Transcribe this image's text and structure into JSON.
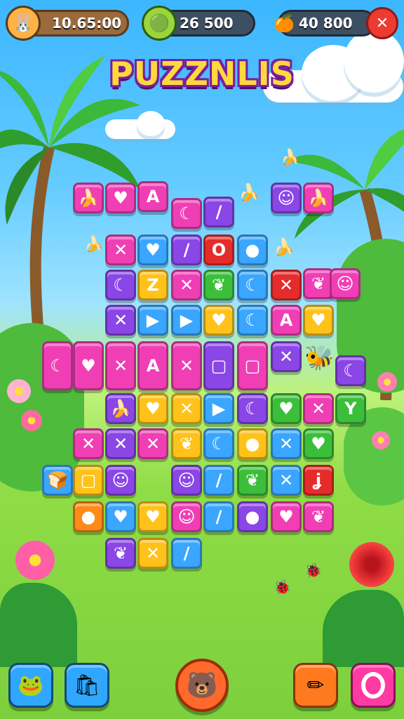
{
  "hud": {
    "time_value": "10.65:00",
    "coins_value": "26 500",
    "gems_value": "40 800",
    "time_icon": "bunny-icon",
    "coins_icon": "coin-icon",
    "gems_icon": "fruit-icon",
    "close_icon": "close-icon"
  },
  "title": "PUZZNLIS",
  "bottom_bar": {
    "left_1_icon": "frog-icon",
    "left_2_icon": "bag-icon",
    "center_icon": "bear-face-icon",
    "right_1_icon": "pencil-icon",
    "right_2_icon": "ring-icon"
  },
  "colors": {
    "pink": "#f03fb5",
    "purple": "#8a46e6",
    "blue": "#3aa6ff",
    "yellow": "#ffc21a",
    "green": "#3bbf3b",
    "red": "#e62b2b",
    "orange": "#ff8a1a",
    "hud_close": "#ee3b32",
    "title_fill": "#ffd93b"
  },
  "board": {
    "tiles": [
      {
        "color": "pink",
        "glyph": "🍌"
      },
      {
        "color": "pink",
        "glyph": "♥"
      },
      {
        "color": "pink",
        "glyph": "A"
      },
      {
        "color": "pink",
        "glyph": "☾"
      },
      {
        "color": "purple",
        "glyph": "/"
      },
      {
        "color": "purple",
        "glyph": "☺"
      },
      {
        "color": "pink",
        "glyph": "🍌"
      },
      {
        "color": "pink",
        "glyph": "✕"
      },
      {
        "color": "blue",
        "glyph": "♥"
      },
      {
        "color": "purple",
        "glyph": "/"
      },
      {
        "color": "red",
        "glyph": "O"
      },
      {
        "color": "blue",
        "glyph": "●"
      },
      {
        "color": "purple",
        "glyph": "☾"
      },
      {
        "color": "yellow",
        "glyph": "Z"
      },
      {
        "color": "pink",
        "glyph": "✕"
      },
      {
        "color": "green",
        "glyph": "❦"
      },
      {
        "color": "blue",
        "glyph": "☾"
      },
      {
        "color": "red",
        "glyph": "✕"
      },
      {
        "color": "pink",
        "glyph": "❦"
      },
      {
        "color": "pink",
        "glyph": "☺"
      },
      {
        "color": "purple",
        "glyph": "✕"
      },
      {
        "color": "blue",
        "glyph": "▶"
      },
      {
        "color": "blue",
        "glyph": "▶"
      },
      {
        "color": "yellow",
        "glyph": "♥"
      },
      {
        "color": "blue",
        "glyph": "☾"
      },
      {
        "color": "pink",
        "glyph": "A"
      },
      {
        "color": "yellow",
        "glyph": "♥"
      },
      {
        "color": "pink",
        "glyph": "☾"
      },
      {
        "color": "pink",
        "glyph": "♥"
      },
      {
        "color": "pink",
        "glyph": "✕"
      },
      {
        "color": "pink",
        "glyph": "A"
      },
      {
        "color": "pink",
        "glyph": "✕"
      },
      {
        "color": "purple",
        "glyph": "▢"
      },
      {
        "color": "pink",
        "glyph": "▢"
      },
      {
        "color": "purple",
        "glyph": "✕"
      },
      {
        "color": "purple",
        "glyph": "☾"
      },
      {
        "color": "purple",
        "glyph": "🍌"
      },
      {
        "color": "yellow",
        "glyph": "♥"
      },
      {
        "color": "yellow",
        "glyph": "✕"
      },
      {
        "color": "blue",
        "glyph": "▶"
      },
      {
        "color": "purple",
        "glyph": "☾"
      },
      {
        "color": "green",
        "glyph": "♥"
      },
      {
        "color": "pink",
        "glyph": "✕"
      },
      {
        "color": "green",
        "glyph": "Y"
      },
      {
        "color": "pink",
        "glyph": "✕"
      },
      {
        "color": "purple",
        "glyph": "✕"
      },
      {
        "color": "pink",
        "glyph": "✕"
      },
      {
        "color": "yellow",
        "glyph": "❦"
      },
      {
        "color": "blue",
        "glyph": "☾"
      },
      {
        "color": "yellow",
        "glyph": "●"
      },
      {
        "color": "blue",
        "glyph": "✕"
      },
      {
        "color": "green",
        "glyph": "♥"
      },
      {
        "color": "blue",
        "glyph": "🍞"
      },
      {
        "color": "yellow",
        "glyph": "▢"
      },
      {
        "color": "purple",
        "glyph": "☺"
      },
      {
        "color": "purple",
        "glyph": "☺"
      },
      {
        "color": "blue",
        "glyph": "/"
      },
      {
        "color": "green",
        "glyph": "❦"
      },
      {
        "color": "blue",
        "glyph": "✕"
      },
      {
        "color": "red",
        "glyph": "ʝ"
      },
      {
        "color": "orange",
        "glyph": "●"
      },
      {
        "color": "blue",
        "glyph": "♥"
      },
      {
        "color": "yellow",
        "glyph": "♥"
      },
      {
        "color": "pink",
        "glyph": "☺"
      },
      {
        "color": "blue",
        "glyph": "/"
      },
      {
        "color": "purple",
        "glyph": "●"
      },
      {
        "color": "pink",
        "glyph": "♥"
      },
      {
        "color": "pink",
        "glyph": "❦"
      },
      {
        "color": "purple",
        "glyph": "❦"
      },
      {
        "color": "yellow",
        "glyph": "✕"
      },
      {
        "color": "blue",
        "glyph": "/"
      }
    ]
  }
}
